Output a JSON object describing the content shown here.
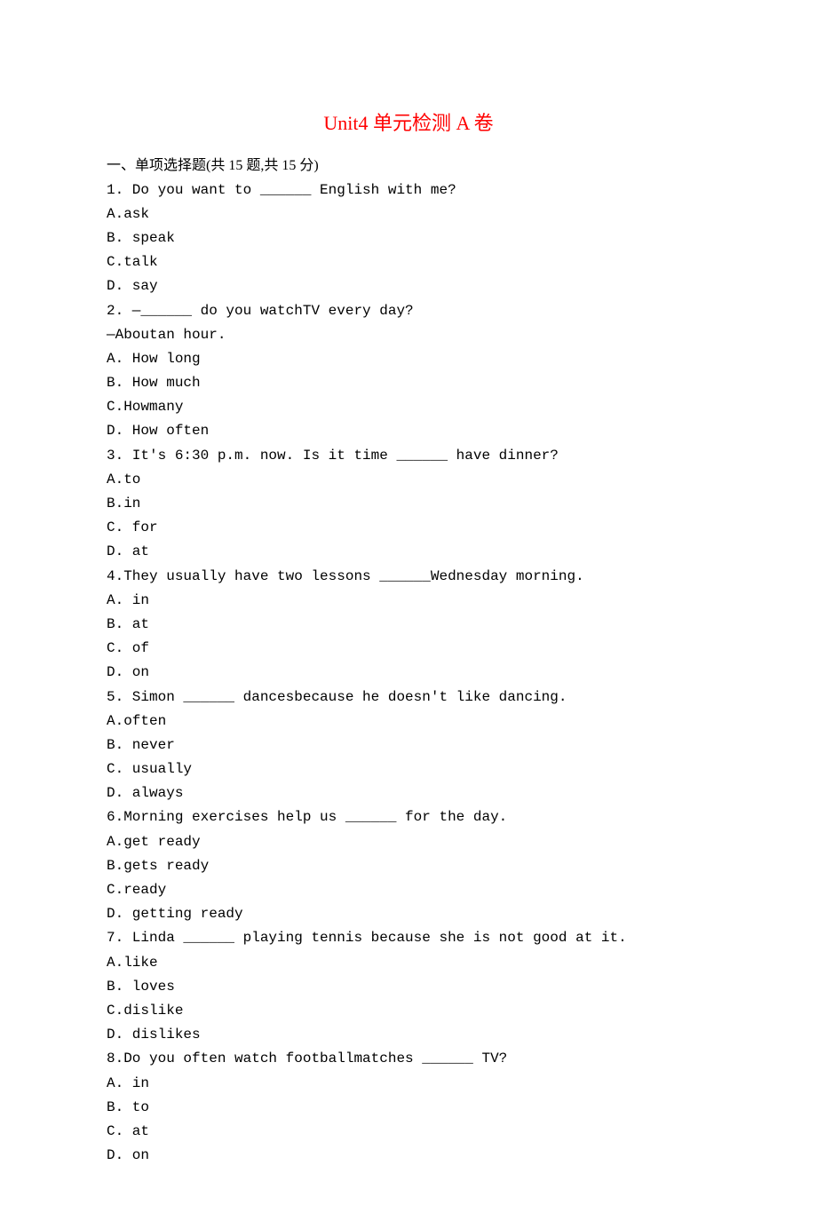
{
  "title": "Unit4 单元检测 A 卷",
  "section": "一、单项选择题(共 15 题,共 15 分)",
  "questions": [
    {
      "lines": [
        "1. Do you want to ______ English with me?"
      ],
      "options": [
        "A.ask",
        "B. speak",
        "C.talk",
        "D. say"
      ]
    },
    {
      "lines": [
        "2. —______ do you watchTV every day?",
        "—Aboutan hour."
      ],
      "options": [
        "A. How long",
        "B. How much",
        "C.Howmany",
        "D. How often"
      ]
    },
    {
      "lines": [
        "3. It's 6:30 p.m. now. Is it time ______ have dinner?"
      ],
      "options": [
        "A.to",
        "B.in",
        "C. for",
        "D. at"
      ]
    },
    {
      "lines": [
        "4.They usually have two lessons ______Wednesday morning."
      ],
      "options": [
        "A. in",
        "B. at",
        "C. of",
        "D. on"
      ]
    },
    {
      "lines": [
        "5. Simon ______ dancesbecause he doesn't like dancing."
      ],
      "options": [
        "A.often",
        "B. never",
        "C. usually",
        "D. always"
      ]
    },
    {
      "lines": [
        "6.Morning exercises help us ______ for the day."
      ],
      "options": [
        "A.get ready",
        "B.gets ready",
        "C.ready",
        "D. getting ready"
      ]
    },
    {
      "lines": [
        "7. Linda ______ playing tennis because she is not good at it."
      ],
      "options": [
        "A.like",
        "B. loves",
        "C.dislike",
        "D. dislikes"
      ]
    },
    {
      "lines": [
        "8.Do you often watch footballmatches ______ TV?"
      ],
      "options": [
        "A. in",
        "B. to",
        "C. at",
        "D. on"
      ]
    }
  ]
}
